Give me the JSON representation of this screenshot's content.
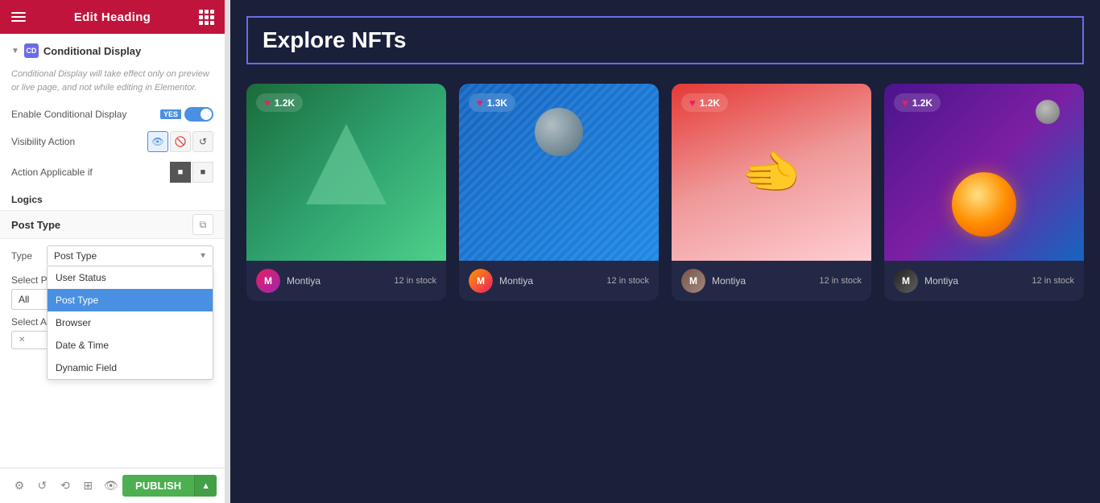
{
  "header": {
    "title": "Edit Heading",
    "hamburger_label": "menu",
    "grid_label": "widgets"
  },
  "section": {
    "title": "Conditional Display",
    "icon_label": "CD",
    "notice": "Conditional Display will take effect only on preview or live page, and not while editing in Elementor."
  },
  "settings": {
    "enable_conditional_display_label": "Enable Conditional Display",
    "toggle_state": "YES",
    "visibility_action_label": "Visibility Action",
    "action_applicable_if_label": "Action Applicable if",
    "logics_label": "Logics",
    "post_type_label": "Post Type",
    "type_label": "Type",
    "select_post_types_label": "Select Post Types",
    "select_any_post_label": "Select Any Post"
  },
  "type_dropdown": {
    "selected": "Post Type",
    "options": [
      {
        "value": "user_status",
        "label": "User Status"
      },
      {
        "value": "post_type",
        "label": "Post Type"
      },
      {
        "value": "browser",
        "label": "Browser"
      },
      {
        "value": "date_time",
        "label": "Date & Time"
      },
      {
        "value": "dynamic_field",
        "label": "Dynamic Field"
      }
    ]
  },
  "post_types_select": {
    "value": "All"
  },
  "tags_placeholder": "",
  "bottom_bar": {
    "publish_label": "PUBLISH"
  },
  "main": {
    "heading": "Explore NFTs",
    "nfts": [
      {
        "likes": "1.2K",
        "username": "Montiya",
        "stock": "12 in stock",
        "bg": "1",
        "avatar": "1"
      },
      {
        "likes": "1.3K",
        "username": "Montiya",
        "stock": "12 in stock",
        "bg": "2",
        "avatar": "2"
      },
      {
        "likes": "1.2K",
        "username": "Montiya",
        "stock": "12 in stock",
        "bg": "3",
        "avatar": "3"
      },
      {
        "likes": "1.2K",
        "username": "Montiya",
        "stock": "12 in stock",
        "bg": "4",
        "avatar": "4"
      }
    ]
  }
}
